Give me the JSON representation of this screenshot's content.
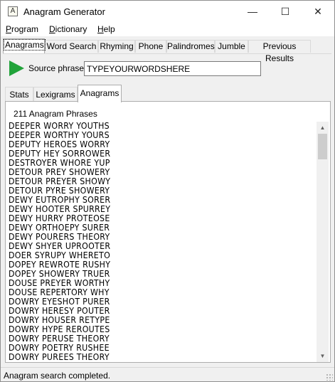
{
  "window": {
    "title": "Anagram Generator",
    "app_icon_glyph": "A"
  },
  "window_controls": {
    "minimize": "—",
    "maximize": "☐",
    "close": "✕"
  },
  "menu": [
    {
      "label": "Program",
      "underline": "P",
      "rest": "rogram"
    },
    {
      "label": "Dictionary",
      "underline": "D",
      "rest": "ictionary"
    },
    {
      "label": "Help",
      "underline": "H",
      "rest": "elp"
    }
  ],
  "tabs": [
    "Anagrams",
    "Word Search",
    "Rhyming",
    "Phone",
    "Palindromes",
    "Jumble",
    "Previous Results"
  ],
  "active_tab": "Anagrams",
  "source": {
    "label": "Source phrase",
    "value": "TYPEYOURWORDSHERE",
    "play_color": "#21a33a"
  },
  "subtabs": [
    "Stats",
    "Lexigrams",
    "Anagrams"
  ],
  "active_subtab": "Anagrams",
  "results": {
    "count_label": "211 Anagram Phrases",
    "items": [
      "DEEPER WORRY YOUTHS",
      "DEEPER WORTHY YOURS",
      "DEPUTY HEROES WORRY",
      "DEPUTY HEY SORROWER",
      "DESTROYER WHORE YUP",
      "DETOUR PREY SHOWERY",
      "DETOUR PREYER SHOWY",
      "DETOUR PYRE SHOWERY",
      "DEWY EUTROPHY SORER",
      "DEWY HOOTER SPURREY",
      "DEWY HURRY PROTEOSE",
      "DEWY ORTHOEPY SURER",
      "DEWY POURERS THEORY",
      "DEWY SHYER UPROOTER",
      "DOER SYRUPY WHERETO",
      "DOPEY REWROTE RUSHY",
      "DOPEY SHOWERY TRUER",
      "DOUSE PREYER WORTHY",
      "DOUSE REPERTORY WHY",
      "DOWRY EYESHOT PURER",
      "DOWRY HERESY POUTER",
      "DOWRY HOUSER RETYPE",
      "DOWRY HYPE REROUTES",
      "DOWRY PERUSE THEORY",
      "DOWRY POETRY RUSHEE",
      "DOWRY PUREES THEORY"
    ]
  },
  "scrollbar": {
    "up": "▲",
    "down": "▼"
  },
  "status": {
    "text": "Anagram search completed."
  }
}
